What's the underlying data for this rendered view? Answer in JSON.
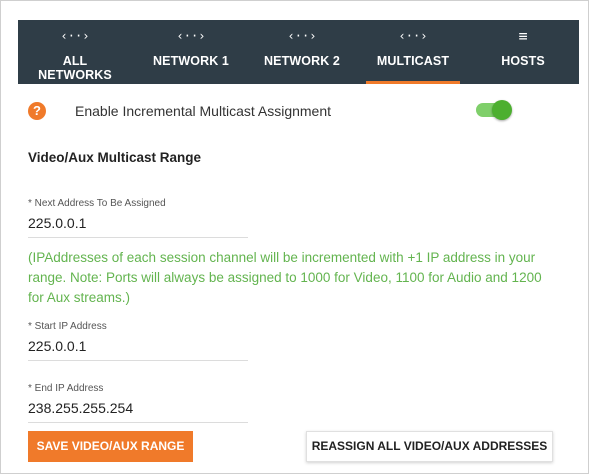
{
  "tabs": [
    {
      "icon_name": "network-code-icon",
      "icon_glyph": "‹··›",
      "label": "ALL NETWORKS"
    },
    {
      "icon_name": "network-code-icon",
      "icon_glyph": "‹··›",
      "label": "NETWORK 1"
    },
    {
      "icon_name": "network-code-icon",
      "icon_glyph": "‹··›",
      "label": "NETWORK 2"
    },
    {
      "icon_name": "network-code-icon",
      "icon_glyph": "‹··›",
      "label": "MULTICAST",
      "active": true
    },
    {
      "icon_name": "list-icon",
      "icon_glyph": "≡",
      "label": "HOSTS"
    }
  ],
  "multicast": {
    "help_glyph": "?",
    "incremental_label": "Enable Incremental Multicast Assignment",
    "incremental_enabled": true,
    "section_title": "Video/Aux Multicast Range",
    "next_address_label": "* Next Address To Be Assigned",
    "next_address_value": "225.0.0.1",
    "note": "(IPAddresses of each session channel will be incremented with +1 IP address in your range. Note: Ports will always be assigned to 1000 for Video, 1100 for Audio and 1200 for Aux streams.)",
    "start_ip_label": "* Start IP Address",
    "start_ip_value": "225.0.0.1",
    "end_ip_label": "* End IP Address",
    "end_ip_value": "238.255.255.254",
    "save_button": "SAVE VIDEO/AUX RANGE",
    "reassign_button": "REASSIGN ALL VIDEO/AUX ADDRESSES"
  },
  "colors": {
    "tabbar_bg": "#2f3d47",
    "accent": "#f07a2a",
    "toggle_on": "#4caf2f",
    "note_text": "#63b44f"
  }
}
